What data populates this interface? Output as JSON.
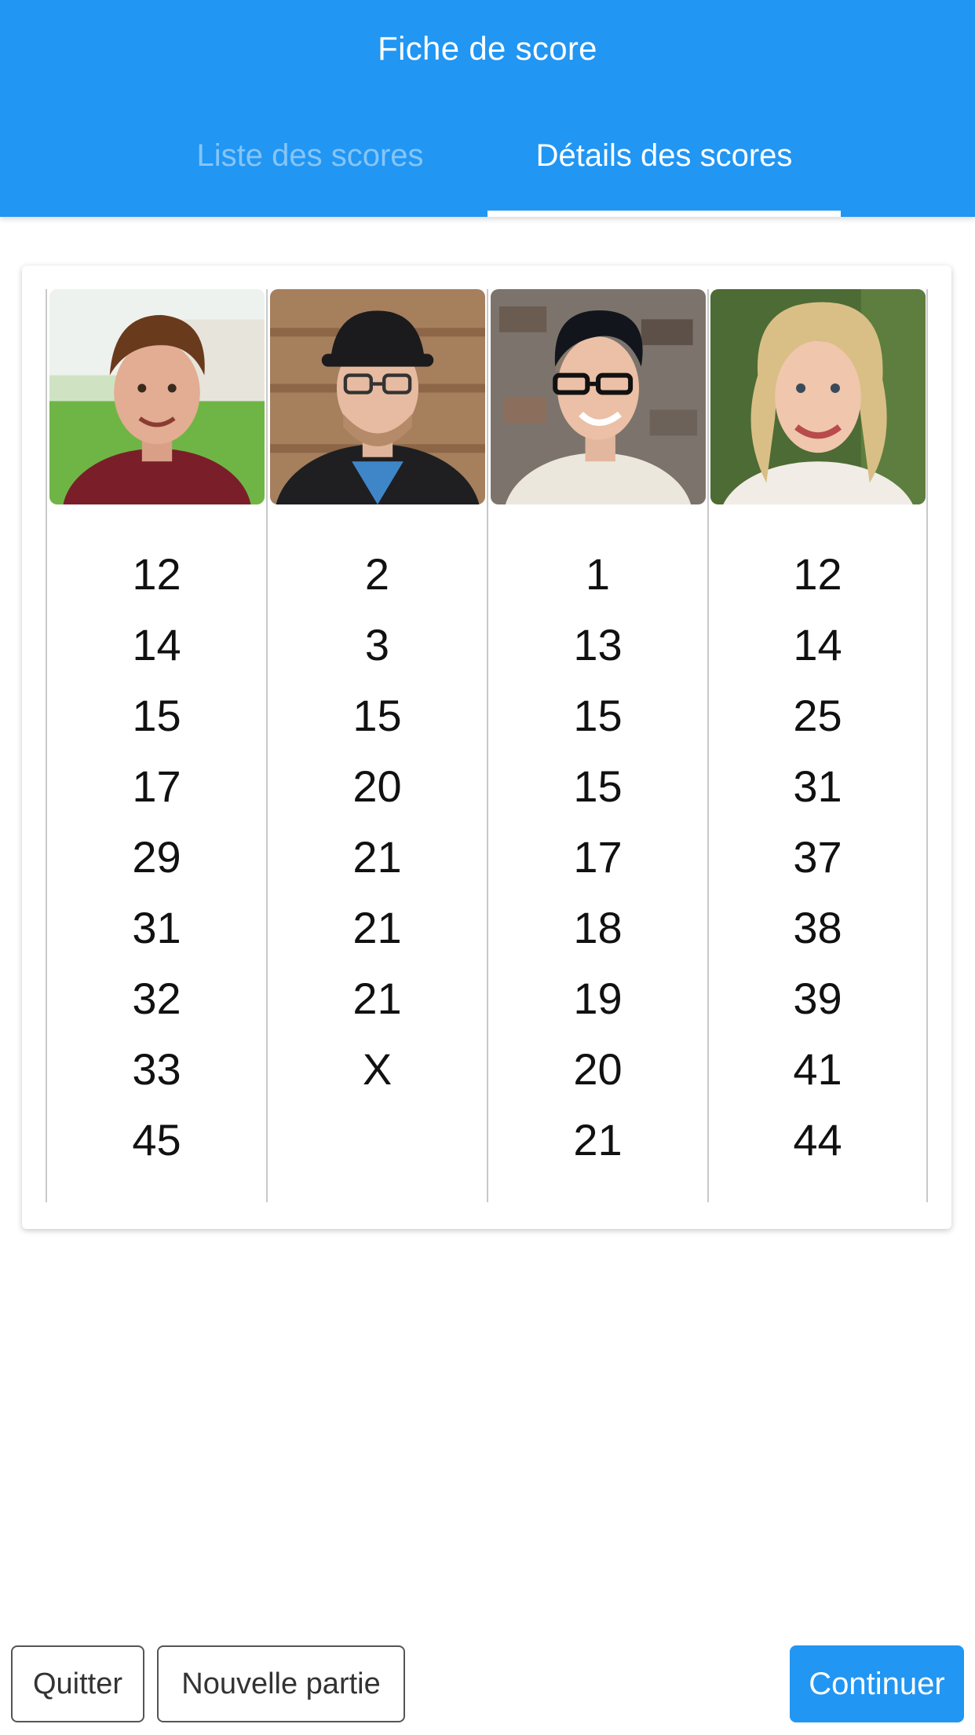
{
  "header": {
    "title": "Fiche de score",
    "tabs": [
      {
        "label": "Liste des scores",
        "active": false
      },
      {
        "label": "Détails des scores",
        "active": true
      }
    ]
  },
  "colors": {
    "primary": "#2196F3",
    "inactive_tab": "rgba(255,255,255,0.45)"
  },
  "players": [
    {
      "avatar": "player-1-avatar",
      "scores": [
        "12",
        "14",
        "15",
        "17",
        "29",
        "31",
        "32",
        "33",
        "45"
      ]
    },
    {
      "avatar": "player-2-avatar",
      "scores": [
        "2",
        "3",
        "15",
        "20",
        "21",
        "21",
        "21",
        "X"
      ]
    },
    {
      "avatar": "player-3-avatar",
      "scores": [
        "1",
        "13",
        "15",
        "15",
        "17",
        "18",
        "19",
        "20",
        "21"
      ]
    },
    {
      "avatar": "player-4-avatar",
      "scores": [
        "12",
        "14",
        "25",
        "31",
        "37",
        "38",
        "39",
        "41",
        "44"
      ]
    }
  ],
  "footer": {
    "quit_label": "Quitter",
    "new_game_label": "Nouvelle partie",
    "continue_label": "Continuer"
  }
}
